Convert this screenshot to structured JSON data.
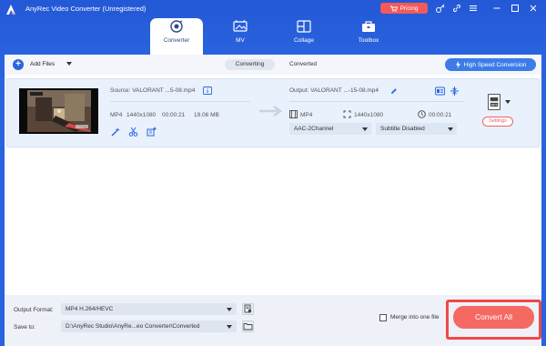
{
  "window": {
    "title": "AnyRec Video Converter (Unregistered)",
    "pricing_label": "Pricing",
    "header_icons": [
      "key-icon",
      "link-icon",
      "menu-icon",
      "minimize-icon",
      "maximize-icon",
      "close-icon"
    ]
  },
  "nav": {
    "tabs": [
      {
        "label": "Converter",
        "icon": "converter-icon",
        "active": true
      },
      {
        "label": "MV",
        "icon": "mv-icon",
        "active": false
      },
      {
        "label": "Collage",
        "icon": "collage-icon",
        "active": false
      },
      {
        "label": "Toolbox",
        "icon": "toolbox-icon",
        "active": false
      }
    ]
  },
  "toolbar": {
    "add_files_label": "Add Files",
    "converting_label": "Converting",
    "converted_label": "Converted",
    "high_speed_label": "High Speed Conversion"
  },
  "file": {
    "source_label": "Source: VALORANT ...5-08.mp4",
    "src_format": "MP4",
    "src_resolution": "1440x1080",
    "src_duration": "00:00:21",
    "src_size": "19.06 MB",
    "output_label": "Output: VALORANT ...-15-08.mp4",
    "out_format": "MP4",
    "out_resolution": "1440x1080",
    "out_duration": "00:00:21",
    "audio_track": "AAC-2Channel",
    "subtitle": "Subtitle Disabled",
    "format_badge": "MP4",
    "settings_label": "Settings"
  },
  "bottom": {
    "output_format_label": "Output Format:",
    "output_format_value": "MP4 H.264/HEVC",
    "save_to_label": "Save to:",
    "save_to_value": "D:\\AnyRec Studio\\AnyRe...eo Converter\\Converted",
    "merge_label": "Merge into one file",
    "convert_all_label": "Convert All"
  },
  "colors": {
    "header_blue": "#2a63de",
    "accent_red": "#f04848",
    "convert_button": "#f46a63",
    "file_row_bg": "#e9f1fc"
  }
}
